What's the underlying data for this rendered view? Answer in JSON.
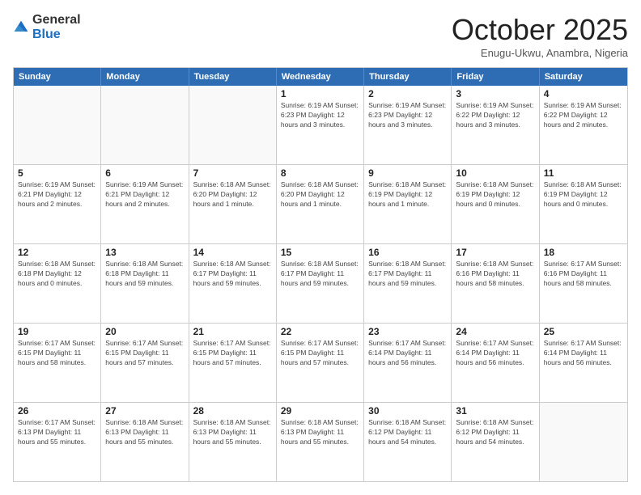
{
  "logo": {
    "general": "General",
    "blue": "Blue"
  },
  "header": {
    "month": "October 2025",
    "location": "Enugu-Ukwu, Anambra, Nigeria"
  },
  "weekdays": [
    "Sunday",
    "Monday",
    "Tuesday",
    "Wednesday",
    "Thursday",
    "Friday",
    "Saturday"
  ],
  "rows": [
    [
      {
        "day": "",
        "info": ""
      },
      {
        "day": "",
        "info": ""
      },
      {
        "day": "",
        "info": ""
      },
      {
        "day": "1",
        "info": "Sunrise: 6:19 AM\nSunset: 6:23 PM\nDaylight: 12 hours\nand 3 minutes."
      },
      {
        "day": "2",
        "info": "Sunrise: 6:19 AM\nSunset: 6:23 PM\nDaylight: 12 hours\nand 3 minutes."
      },
      {
        "day": "3",
        "info": "Sunrise: 6:19 AM\nSunset: 6:22 PM\nDaylight: 12 hours\nand 3 minutes."
      },
      {
        "day": "4",
        "info": "Sunrise: 6:19 AM\nSunset: 6:22 PM\nDaylight: 12 hours\nand 2 minutes."
      }
    ],
    [
      {
        "day": "5",
        "info": "Sunrise: 6:19 AM\nSunset: 6:21 PM\nDaylight: 12 hours\nand 2 minutes."
      },
      {
        "day": "6",
        "info": "Sunrise: 6:19 AM\nSunset: 6:21 PM\nDaylight: 12 hours\nand 2 minutes."
      },
      {
        "day": "7",
        "info": "Sunrise: 6:18 AM\nSunset: 6:20 PM\nDaylight: 12 hours\nand 1 minute."
      },
      {
        "day": "8",
        "info": "Sunrise: 6:18 AM\nSunset: 6:20 PM\nDaylight: 12 hours\nand 1 minute."
      },
      {
        "day": "9",
        "info": "Sunrise: 6:18 AM\nSunset: 6:19 PM\nDaylight: 12 hours\nand 1 minute."
      },
      {
        "day": "10",
        "info": "Sunrise: 6:18 AM\nSunset: 6:19 PM\nDaylight: 12 hours\nand 0 minutes."
      },
      {
        "day": "11",
        "info": "Sunrise: 6:18 AM\nSunset: 6:19 PM\nDaylight: 12 hours\nand 0 minutes."
      }
    ],
    [
      {
        "day": "12",
        "info": "Sunrise: 6:18 AM\nSunset: 6:18 PM\nDaylight: 12 hours\nand 0 minutes."
      },
      {
        "day": "13",
        "info": "Sunrise: 6:18 AM\nSunset: 6:18 PM\nDaylight: 11 hours\nand 59 minutes."
      },
      {
        "day": "14",
        "info": "Sunrise: 6:18 AM\nSunset: 6:17 PM\nDaylight: 11 hours\nand 59 minutes."
      },
      {
        "day": "15",
        "info": "Sunrise: 6:18 AM\nSunset: 6:17 PM\nDaylight: 11 hours\nand 59 minutes."
      },
      {
        "day": "16",
        "info": "Sunrise: 6:18 AM\nSunset: 6:17 PM\nDaylight: 11 hours\nand 59 minutes."
      },
      {
        "day": "17",
        "info": "Sunrise: 6:18 AM\nSunset: 6:16 PM\nDaylight: 11 hours\nand 58 minutes."
      },
      {
        "day": "18",
        "info": "Sunrise: 6:17 AM\nSunset: 6:16 PM\nDaylight: 11 hours\nand 58 minutes."
      }
    ],
    [
      {
        "day": "19",
        "info": "Sunrise: 6:17 AM\nSunset: 6:15 PM\nDaylight: 11 hours\nand 58 minutes."
      },
      {
        "day": "20",
        "info": "Sunrise: 6:17 AM\nSunset: 6:15 PM\nDaylight: 11 hours\nand 57 minutes."
      },
      {
        "day": "21",
        "info": "Sunrise: 6:17 AM\nSunset: 6:15 PM\nDaylight: 11 hours\nand 57 minutes."
      },
      {
        "day": "22",
        "info": "Sunrise: 6:17 AM\nSunset: 6:15 PM\nDaylight: 11 hours\nand 57 minutes."
      },
      {
        "day": "23",
        "info": "Sunrise: 6:17 AM\nSunset: 6:14 PM\nDaylight: 11 hours\nand 56 minutes."
      },
      {
        "day": "24",
        "info": "Sunrise: 6:17 AM\nSunset: 6:14 PM\nDaylight: 11 hours\nand 56 minutes."
      },
      {
        "day": "25",
        "info": "Sunrise: 6:17 AM\nSunset: 6:14 PM\nDaylight: 11 hours\nand 56 minutes."
      }
    ],
    [
      {
        "day": "26",
        "info": "Sunrise: 6:17 AM\nSunset: 6:13 PM\nDaylight: 11 hours\nand 55 minutes."
      },
      {
        "day": "27",
        "info": "Sunrise: 6:18 AM\nSunset: 6:13 PM\nDaylight: 11 hours\nand 55 minutes."
      },
      {
        "day": "28",
        "info": "Sunrise: 6:18 AM\nSunset: 6:13 PM\nDaylight: 11 hours\nand 55 minutes."
      },
      {
        "day": "29",
        "info": "Sunrise: 6:18 AM\nSunset: 6:13 PM\nDaylight: 11 hours\nand 55 minutes."
      },
      {
        "day": "30",
        "info": "Sunrise: 6:18 AM\nSunset: 6:12 PM\nDaylight: 11 hours\nand 54 minutes."
      },
      {
        "day": "31",
        "info": "Sunrise: 6:18 AM\nSunset: 6:12 PM\nDaylight: 11 hours\nand 54 minutes."
      },
      {
        "day": "",
        "info": ""
      }
    ]
  ]
}
